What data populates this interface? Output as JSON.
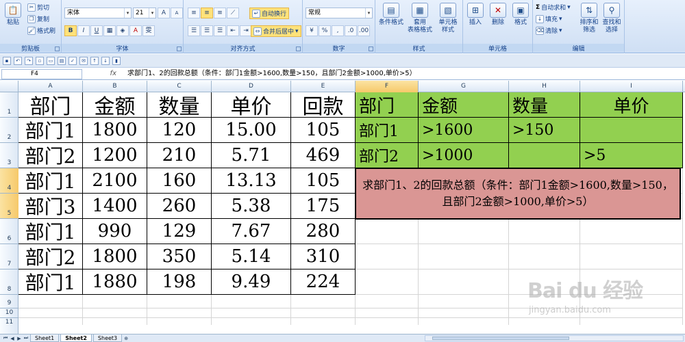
{
  "ribbon": {
    "clipboard": {
      "paste": "粘贴",
      "cut": "剪切",
      "copy": "复制",
      "format_painter": "格式刷",
      "label": "剪贴板"
    },
    "font": {
      "name": "宋体",
      "size": "21",
      "label": "字体",
      "bold": "B",
      "italic": "I",
      "underline": "U",
      "grow": "A",
      "shrink": "A",
      "phonetic": "雯"
    },
    "alignment": {
      "wrap": "自动换行",
      "merge": "合并后居中",
      "label": "对齐方式"
    },
    "number": {
      "format": "常规",
      "percent": "%",
      "comma": ",",
      "label": "数字"
    },
    "styles": {
      "conditional": "条件格式",
      "table_line1": "套用",
      "table_line2": "表格格式",
      "cell_line1": "单元格",
      "cell_line2": "样式",
      "label": "样式"
    },
    "cells": {
      "insert": "插入",
      "delete": "删除",
      "format": "格式",
      "label": "单元格"
    },
    "editing": {
      "autosum": "自动求和",
      "fill": "填充",
      "clear": "清除",
      "sort_line1": "排序和",
      "sort_line2": "筛选",
      "find_line1": "查找和",
      "find_line2": "选择",
      "label": "编辑"
    }
  },
  "formula_bar": {
    "name_box": "F4",
    "fx": "fx",
    "content": "求部门1、2的回款总额（条件：部门1金额>1600,数量>150，且部门2金额>1000,单价>5）"
  },
  "columns": [
    "A",
    "B",
    "C",
    "D",
    "E",
    "F",
    "G",
    "H",
    "I"
  ],
  "rows": [
    "1",
    "2",
    "3",
    "4",
    "5",
    "6",
    "7",
    "8",
    "9",
    "10",
    "11"
  ],
  "table": {
    "headers": [
      "部门",
      "金额",
      "数量",
      "单价",
      "回款"
    ],
    "rows": [
      [
        "部门1",
        "1800",
        "120",
        "15.00",
        "105"
      ],
      [
        "部门2",
        "1200",
        "210",
        "5.71",
        "469"
      ],
      [
        "部门1",
        "2100",
        "160",
        "13.13",
        "105"
      ],
      [
        "部门3",
        "1400",
        "260",
        "5.38",
        "175"
      ],
      [
        "部门1",
        "990",
        "129",
        "7.67",
        "280"
      ],
      [
        "部门2",
        "1800",
        "350",
        "5.14",
        "310"
      ],
      [
        "部门1",
        "1880",
        "198",
        "9.49",
        "224"
      ]
    ]
  },
  "criteria": {
    "headers": [
      "部门",
      "金额",
      "数量",
      "单价"
    ],
    "rows": [
      [
        "部门1",
        ">1600",
        ">150",
        ""
      ],
      [
        "部门2",
        ">1000",
        "",
        ">5"
      ]
    ]
  },
  "note": "求部门1、2的回款总额（条件：部门1金额>1600,数量>150，且部门2金额>1000,单价>5）",
  "sheets": [
    "Sheet1",
    "Sheet2",
    "Sheet3"
  ],
  "active_sheet": "Sheet2",
  "watermark": {
    "line1": "Bai du 经验",
    "line2": "jingyan.baidu.com"
  },
  "colors": {
    "criteria_fill": "#92d050",
    "note_fill": "#da9694",
    "selection_header": "#f6c96a"
  }
}
